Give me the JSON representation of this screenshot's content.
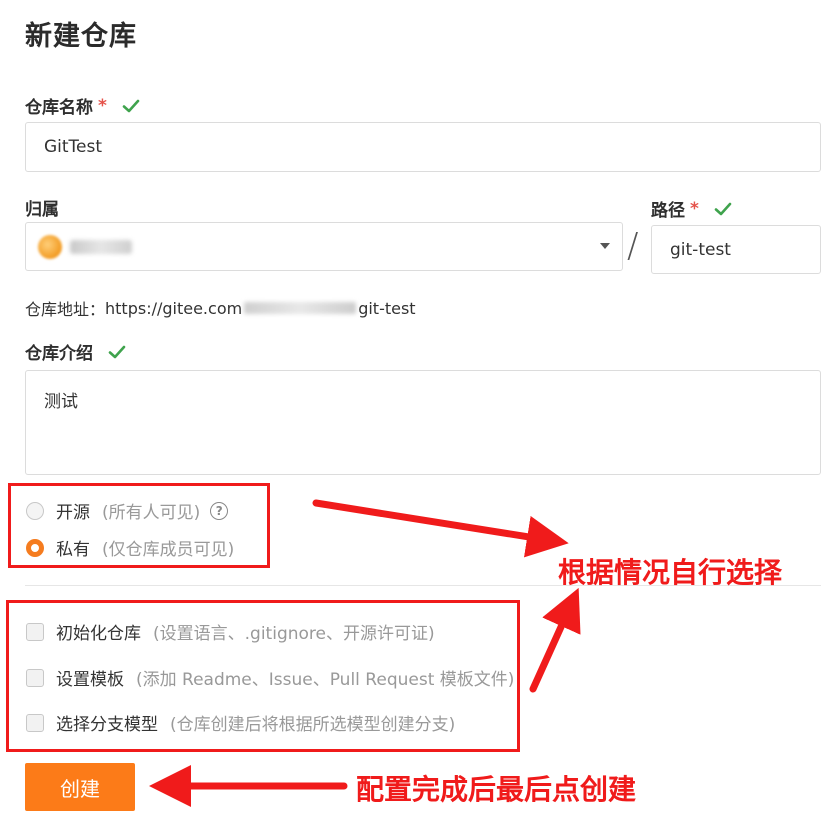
{
  "page": {
    "title": "新建仓库"
  },
  "repo_name": {
    "label": "仓库名称",
    "required_mark": "*",
    "value": "GitTest"
  },
  "owner": {
    "label": "归属"
  },
  "path": {
    "label": "路径",
    "required_mark": "*",
    "value": "git-test",
    "separator": "/"
  },
  "address": {
    "label": "仓库地址：",
    "prefix": "https://gitee.com",
    "suffix": "git-test"
  },
  "description": {
    "label": "仓库介绍",
    "value": "测试"
  },
  "visibility": {
    "options": [
      {
        "label": "开源",
        "hint": "(所有人可见)",
        "checked": false
      },
      {
        "label": "私有",
        "hint": "(仅仓库成员可见)",
        "checked": true
      }
    ],
    "help_glyph": "?"
  },
  "options": [
    {
      "label": "初始化仓库",
      "hint": "(设置语言、.gitignore、开源许可证)"
    },
    {
      "label": "设置模板",
      "hint": "(添加 Readme、Issue、Pull Request 模板文件)"
    },
    {
      "label": "选择分支模型",
      "hint": "(仓库创建后将根据所选模型创建分支)"
    }
  ],
  "create_button": {
    "label": "创建"
  },
  "annotations": {
    "choose": "根据情况自行选择",
    "create": "配置完成后最后点创建"
  },
  "colors": {
    "accent": "#fc7b18",
    "annotation": "#f01b1b",
    "check": "#3fa34d"
  }
}
